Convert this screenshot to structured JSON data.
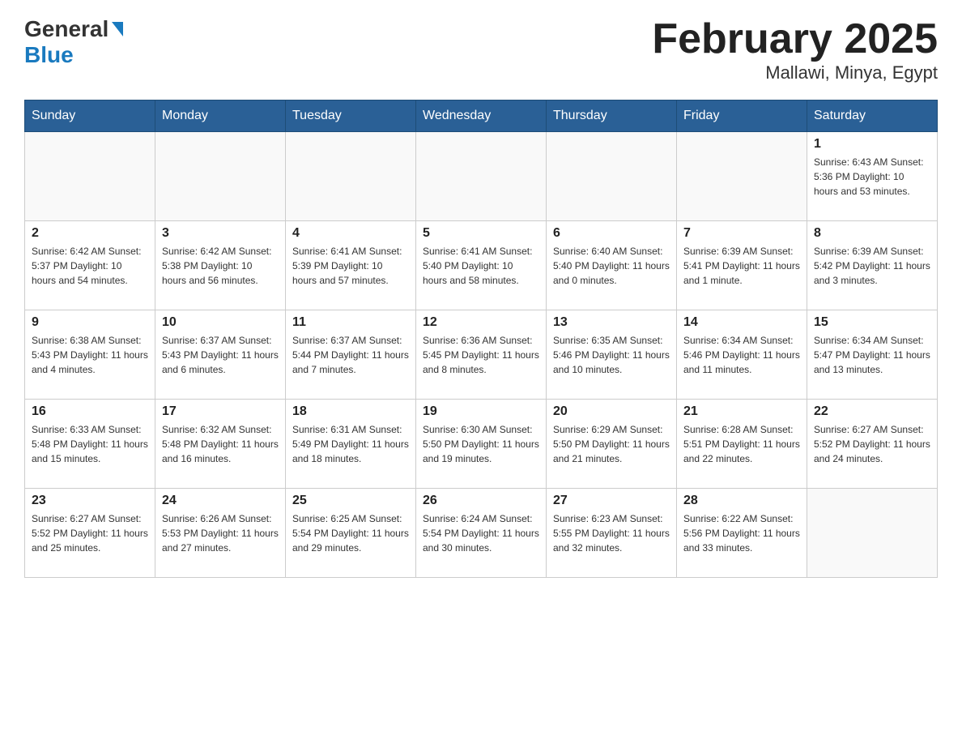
{
  "header": {
    "logo_general": "General",
    "logo_blue": "Blue",
    "title": "February 2025",
    "subtitle": "Mallawi, Minya, Egypt"
  },
  "weekdays": [
    "Sunday",
    "Monday",
    "Tuesday",
    "Wednesday",
    "Thursday",
    "Friday",
    "Saturday"
  ],
  "weeks": [
    [
      {
        "day": "",
        "info": ""
      },
      {
        "day": "",
        "info": ""
      },
      {
        "day": "",
        "info": ""
      },
      {
        "day": "",
        "info": ""
      },
      {
        "day": "",
        "info": ""
      },
      {
        "day": "",
        "info": ""
      },
      {
        "day": "1",
        "info": "Sunrise: 6:43 AM\nSunset: 5:36 PM\nDaylight: 10 hours\nand 53 minutes."
      }
    ],
    [
      {
        "day": "2",
        "info": "Sunrise: 6:42 AM\nSunset: 5:37 PM\nDaylight: 10 hours\nand 54 minutes."
      },
      {
        "day": "3",
        "info": "Sunrise: 6:42 AM\nSunset: 5:38 PM\nDaylight: 10 hours\nand 56 minutes."
      },
      {
        "day": "4",
        "info": "Sunrise: 6:41 AM\nSunset: 5:39 PM\nDaylight: 10 hours\nand 57 minutes."
      },
      {
        "day": "5",
        "info": "Sunrise: 6:41 AM\nSunset: 5:40 PM\nDaylight: 10 hours\nand 58 minutes."
      },
      {
        "day": "6",
        "info": "Sunrise: 6:40 AM\nSunset: 5:40 PM\nDaylight: 11 hours\nand 0 minutes."
      },
      {
        "day": "7",
        "info": "Sunrise: 6:39 AM\nSunset: 5:41 PM\nDaylight: 11 hours\nand 1 minute."
      },
      {
        "day": "8",
        "info": "Sunrise: 6:39 AM\nSunset: 5:42 PM\nDaylight: 11 hours\nand 3 minutes."
      }
    ],
    [
      {
        "day": "9",
        "info": "Sunrise: 6:38 AM\nSunset: 5:43 PM\nDaylight: 11 hours\nand 4 minutes."
      },
      {
        "day": "10",
        "info": "Sunrise: 6:37 AM\nSunset: 5:43 PM\nDaylight: 11 hours\nand 6 minutes."
      },
      {
        "day": "11",
        "info": "Sunrise: 6:37 AM\nSunset: 5:44 PM\nDaylight: 11 hours\nand 7 minutes."
      },
      {
        "day": "12",
        "info": "Sunrise: 6:36 AM\nSunset: 5:45 PM\nDaylight: 11 hours\nand 8 minutes."
      },
      {
        "day": "13",
        "info": "Sunrise: 6:35 AM\nSunset: 5:46 PM\nDaylight: 11 hours\nand 10 minutes."
      },
      {
        "day": "14",
        "info": "Sunrise: 6:34 AM\nSunset: 5:46 PM\nDaylight: 11 hours\nand 11 minutes."
      },
      {
        "day": "15",
        "info": "Sunrise: 6:34 AM\nSunset: 5:47 PM\nDaylight: 11 hours\nand 13 minutes."
      }
    ],
    [
      {
        "day": "16",
        "info": "Sunrise: 6:33 AM\nSunset: 5:48 PM\nDaylight: 11 hours\nand 15 minutes."
      },
      {
        "day": "17",
        "info": "Sunrise: 6:32 AM\nSunset: 5:48 PM\nDaylight: 11 hours\nand 16 minutes."
      },
      {
        "day": "18",
        "info": "Sunrise: 6:31 AM\nSunset: 5:49 PM\nDaylight: 11 hours\nand 18 minutes."
      },
      {
        "day": "19",
        "info": "Sunrise: 6:30 AM\nSunset: 5:50 PM\nDaylight: 11 hours\nand 19 minutes."
      },
      {
        "day": "20",
        "info": "Sunrise: 6:29 AM\nSunset: 5:50 PM\nDaylight: 11 hours\nand 21 minutes."
      },
      {
        "day": "21",
        "info": "Sunrise: 6:28 AM\nSunset: 5:51 PM\nDaylight: 11 hours\nand 22 minutes."
      },
      {
        "day": "22",
        "info": "Sunrise: 6:27 AM\nSunset: 5:52 PM\nDaylight: 11 hours\nand 24 minutes."
      }
    ],
    [
      {
        "day": "23",
        "info": "Sunrise: 6:27 AM\nSunset: 5:52 PM\nDaylight: 11 hours\nand 25 minutes."
      },
      {
        "day": "24",
        "info": "Sunrise: 6:26 AM\nSunset: 5:53 PM\nDaylight: 11 hours\nand 27 minutes."
      },
      {
        "day": "25",
        "info": "Sunrise: 6:25 AM\nSunset: 5:54 PM\nDaylight: 11 hours\nand 29 minutes."
      },
      {
        "day": "26",
        "info": "Sunrise: 6:24 AM\nSunset: 5:54 PM\nDaylight: 11 hours\nand 30 minutes."
      },
      {
        "day": "27",
        "info": "Sunrise: 6:23 AM\nSunset: 5:55 PM\nDaylight: 11 hours\nand 32 minutes."
      },
      {
        "day": "28",
        "info": "Sunrise: 6:22 AM\nSunset: 5:56 PM\nDaylight: 11 hours\nand 33 minutes."
      },
      {
        "day": "",
        "info": ""
      }
    ]
  ]
}
